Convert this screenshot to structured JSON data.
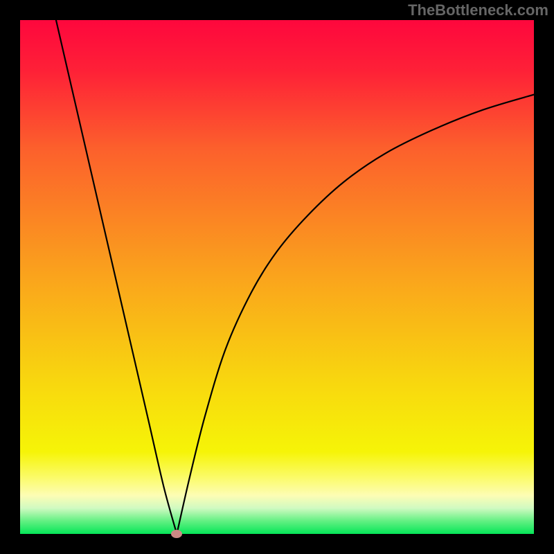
{
  "attribution": "TheBottleneck.com",
  "chart_data": {
    "type": "line",
    "title": "",
    "xlabel": "",
    "ylabel": "",
    "xlim": [
      0,
      100
    ],
    "ylim": [
      0,
      100
    ],
    "left_curve": {
      "x": [
        7,
        10,
        13,
        16,
        19,
        22,
        25,
        28,
        30.5
      ],
      "y": [
        100,
        87,
        74,
        61,
        48,
        35,
        22,
        9,
        0
      ]
    },
    "right_curve": {
      "x": [
        30.5,
        33,
        36,
        40,
        45,
        50,
        56,
        63,
        71,
        80,
        90,
        100
      ],
      "y": [
        0,
        11,
        23,
        36,
        47,
        55,
        62,
        68.5,
        74,
        78.5,
        82.5,
        85.5
      ]
    },
    "minimum_point": {
      "x": 30.5,
      "y": 0
    },
    "background_gradient": {
      "stops": [
        {
          "pos": 0.0,
          "color": "#fe073d"
        },
        {
          "pos": 0.1,
          "color": "#fe2137"
        },
        {
          "pos": 0.25,
          "color": "#fc602c"
        },
        {
          "pos": 0.5,
          "color": "#faa41c"
        },
        {
          "pos": 0.7,
          "color": "#f8d60f"
        },
        {
          "pos": 0.84,
          "color": "#f6f407"
        },
        {
          "pos": 0.89,
          "color": "#fbfb69"
        },
        {
          "pos": 0.925,
          "color": "#fdfdb4"
        },
        {
          "pos": 0.95,
          "color": "#d0fac1"
        },
        {
          "pos": 0.975,
          "color": "#62f082"
        },
        {
          "pos": 1.0,
          "color": "#06e658"
        }
      ]
    },
    "marker_color": "#cd8985"
  }
}
